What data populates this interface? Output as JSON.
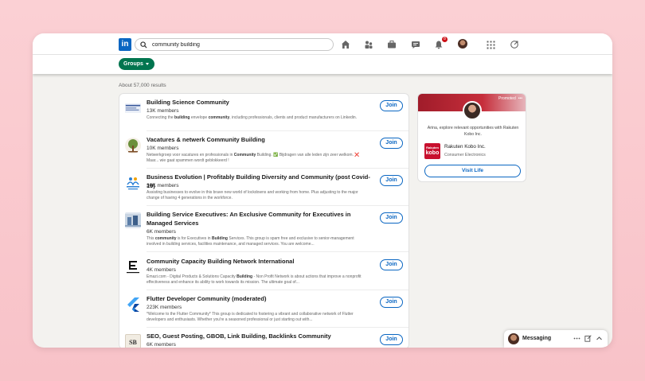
{
  "search": {
    "query": "community building"
  },
  "nav": {
    "notifications_count": "8"
  },
  "filters": {
    "groups_label": "Groups"
  },
  "results_count": "About 57,000 results",
  "join_label": "Join",
  "results": [
    {
      "title": "Building Science Community",
      "members": "13K members",
      "desc_html": "Connecting the <b>building</b> envelope <b>community</b>, including professionals, clients and product manufacturers on Linkedin."
    },
    {
      "title": "Vacatures & netwerk Community Building",
      "members": "10K members",
      "desc_html": "Netwerkgroep voor vacatures en professionals in <b>Community</b> Building. ✅ Bijdragen van alle leden zijn zeer welkom. ❌ Maar... wie gaat spammen wordt geblokkeerd !"
    },
    {
      "title": "Business Evolution | Profitably Building Diversity and Community (post Covid-19)",
      "members": "30K members",
      "desc_html": "Assisting businesses to evolve in this brave new world of lockdowns and working from home. Plus adjusting to the major change of having 4 generations in the workforce."
    },
    {
      "title": "Building Service Executives: An Exclusive Community for Executives in Managed Services",
      "members": "6K members",
      "desc_html": "This <b>community</b> is for Executives in <b>Building</b> Services. This group is spam free and exclusive to senior-management involved in building services, facilities maintenance, and managed services. You are welcome..."
    },
    {
      "title": "Community Capacity Building Network International",
      "members": "4K members",
      "desc_html": "Emazi.com - Digital Products & Solutions Capacity <b>Building</b> - Non Profit Network is about actions that improve a nonprofit effectiveness and enhance its ability to work towards its mission. The ultimate goal of..."
    },
    {
      "title": "Flutter Developer Community (moderated)",
      "members": "223K members",
      "desc_html": "*Welcome to the Flutter Community* This group is dedicated to fostering a vibrant and collaborative network of Flutter developers and enthusiasts. Whether you're a seasoned professional or just starting out with..."
    },
    {
      "title": "SEO, Guest Posting, GBOB, Link Building, Backlinks Community",
      "members": "6K members",
      "desc_html": ""
    }
  ],
  "ad": {
    "promoted_label": "Promoted",
    "text": "Arina, explore relevant opportunities with Rakuten Kobo Inc.",
    "logo_top": "Rakuten",
    "logo_bottom": "kobo",
    "company": "Rakuten Kobo Inc.",
    "industry": "Consumer Electronics",
    "button": "Visit Life"
  },
  "messaging": {
    "label": "Messaging"
  },
  "colors": {
    "brand": "#0a66c2",
    "groups_pill": "#01754f",
    "kobo": "#c8102e"
  }
}
